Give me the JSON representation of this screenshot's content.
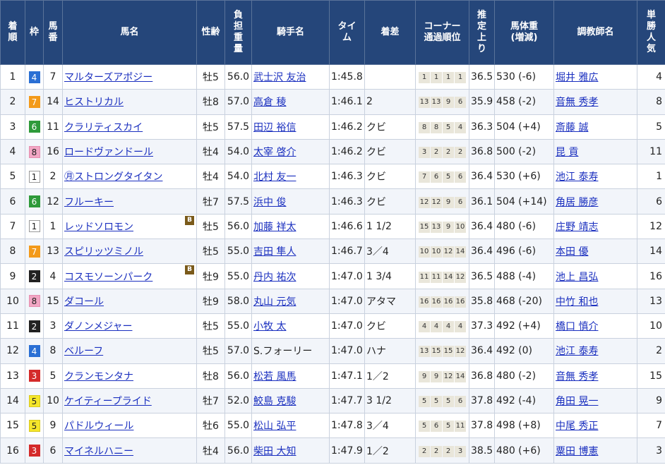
{
  "headers": {
    "rank": [
      "着",
      "順"
    ],
    "waku": [
      "枠"
    ],
    "umaban": [
      "馬",
      "番"
    ],
    "horse": [
      "馬名"
    ],
    "sexage": [
      "性齢"
    ],
    "weight": [
      "負",
      "担",
      "重",
      "量"
    ],
    "jockey": [
      "騎手名"
    ],
    "time": [
      "タイ",
      "ム"
    ],
    "margin": [
      "着差"
    ],
    "corner": [
      "コーナー",
      "通過順位"
    ],
    "last3f": [
      "推",
      "定",
      "上",
      "り"
    ],
    "bodyweight": [
      "馬体重",
      "(増減)"
    ],
    "trainer": [
      "調教師名"
    ],
    "popularity": [
      "単",
      "勝",
      "人",
      "気"
    ]
  },
  "waku_colors": {
    "1": {
      "bg": "#ffffff",
      "fg": "#222222",
      "border": "#999999"
    },
    "2": {
      "bg": "#222222",
      "fg": "#ffffff",
      "border": "#222222"
    },
    "3": {
      "bg": "#d42a2a",
      "fg": "#ffffff",
      "border": "#d42a2a"
    },
    "4": {
      "bg": "#2a6fd4",
      "fg": "#ffffff",
      "border": "#2a6fd4"
    },
    "5": {
      "bg": "#f5e62a",
      "fg": "#222222",
      "border": "#d8c820"
    },
    "6": {
      "bg": "#2e9a3a",
      "fg": "#ffffff",
      "border": "#2e9a3a"
    },
    "7": {
      "bg": "#f39a1a",
      "fg": "#ffffff",
      "border": "#f39a1a"
    },
    "8": {
      "bg": "#f2a6c4",
      "fg": "#222222",
      "border": "#e58fb0"
    }
  },
  "rows": [
    {
      "rank": "1",
      "waku": "4",
      "umaban": "7",
      "horse": "マルターズアポジー",
      "blinker": "",
      "sexage": "牡5",
      "weight": "56.0",
      "jockey": "武士沢 友治",
      "time": "1:45.8",
      "margin": "",
      "corner": [
        "1",
        "1",
        "1",
        "1"
      ],
      "last3f": "36.5",
      "bodyweight": "530 (-6)",
      "trainer": "堀井 雅広",
      "pop": "4"
    },
    {
      "rank": "2",
      "waku": "7",
      "umaban": "14",
      "horse": "ヒストリカル",
      "blinker": "",
      "sexage": "牡8",
      "weight": "57.0",
      "jockey": "高倉 稜",
      "time": "1:46.1",
      "margin": "2",
      "corner": [
        "13",
        "13",
        "9",
        "6"
      ],
      "last3f": "35.9",
      "bodyweight": "458 (-2)",
      "trainer": "音無 秀孝",
      "pop": "8"
    },
    {
      "rank": "3",
      "waku": "6",
      "umaban": "11",
      "horse": "クラリティスカイ",
      "blinker": "",
      "sexage": "牡5",
      "weight": "57.5",
      "jockey": "田辺 裕信",
      "time": "1:46.2",
      "margin": "クビ",
      "corner": [
        "8",
        "8",
        "5",
        "4"
      ],
      "last3f": "36.3",
      "bodyweight": "504 (+4)",
      "trainer": "斎藤 誠",
      "pop": "5"
    },
    {
      "rank": "4",
      "waku": "8",
      "umaban": "16",
      "horse": "ロードヴァンドール",
      "blinker": "",
      "sexage": "牡4",
      "weight": "54.0",
      "jockey": "太宰 啓介",
      "time": "1:46.2",
      "margin": "クビ",
      "corner": [
        "3",
        "2",
        "2",
        "2"
      ],
      "last3f": "36.8",
      "bodyweight": "500 (-2)",
      "trainer": "昆 貢",
      "pop": "11"
    },
    {
      "rank": "5",
      "waku": "1",
      "umaban": "2",
      "horse": "㊊ストロングタイタン",
      "blinker": "",
      "sexage": "牡4",
      "weight": "54.0",
      "jockey": "北村 友一",
      "time": "1:46.3",
      "margin": "クビ",
      "corner": [
        "7",
        "6",
        "5",
        "6"
      ],
      "last3f": "36.4",
      "bodyweight": "530 (+6)",
      "trainer": "池江 泰寿",
      "pop": "1"
    },
    {
      "rank": "6",
      "waku": "6",
      "umaban": "12",
      "horse": "フルーキー",
      "blinker": "",
      "sexage": "牡7",
      "weight": "57.5",
      "jockey": "浜中 俊",
      "time": "1:46.3",
      "margin": "クビ",
      "corner": [
        "12",
        "12",
        "9",
        "6"
      ],
      "last3f": "36.1",
      "bodyweight": "504 (+14)",
      "trainer": "角居 勝彦",
      "pop": "6"
    },
    {
      "rank": "7",
      "waku": "1",
      "umaban": "1",
      "horse": "レッドソロモン",
      "blinker": "B",
      "sexage": "牡5",
      "weight": "56.0",
      "jockey": "加藤 祥太",
      "time": "1:46.6",
      "margin": "1 1/2",
      "corner": [
        "15",
        "13",
        "9",
        "10"
      ],
      "last3f": "36.4",
      "bodyweight": "480 (-6)",
      "trainer": "庄野 靖志",
      "pop": "12"
    },
    {
      "rank": "8",
      "waku": "7",
      "umaban": "13",
      "horse": "スピリッツミノル",
      "blinker": "",
      "sexage": "牡5",
      "weight": "55.0",
      "jockey": "吉田 隼人",
      "time": "1:46.7",
      "margin": "3／4",
      "corner": [
        "10",
        "10",
        "12",
        "14"
      ],
      "last3f": "36.4",
      "bodyweight": "496 (-6)",
      "trainer": "本田 優",
      "pop": "14"
    },
    {
      "rank": "9",
      "waku": "2",
      "umaban": "4",
      "horse": "コスモソーンパーク",
      "blinker": "B",
      "sexage": "牡9",
      "weight": "55.0",
      "jockey": "丹内 祐次",
      "time": "1:47.0",
      "margin": "1 3/4",
      "corner": [
        "11",
        "11",
        "14",
        "12"
      ],
      "last3f": "36.5",
      "bodyweight": "488 (-4)",
      "trainer": "池上 昌弘",
      "pop": "16"
    },
    {
      "rank": "10",
      "waku": "8",
      "umaban": "15",
      "horse": "ダコール",
      "blinker": "",
      "sexage": "牡9",
      "weight": "58.0",
      "jockey": "丸山 元気",
      "time": "1:47.0",
      "margin": "アタマ",
      "corner": [
        "16",
        "16",
        "16",
        "16"
      ],
      "last3f": "35.8",
      "bodyweight": "468 (-20)",
      "trainer": "中竹 和也",
      "pop": "13"
    },
    {
      "rank": "11",
      "waku": "2",
      "umaban": "3",
      "horse": "ダノンメジャー",
      "blinker": "",
      "sexage": "牡5",
      "weight": "55.0",
      "jockey": "小牧 太",
      "time": "1:47.0",
      "margin": "クビ",
      "corner": [
        "4",
        "4",
        "4",
        "4"
      ],
      "last3f": "37.3",
      "bodyweight": "492 (+4)",
      "trainer": "橋口 慎介",
      "pop": "10"
    },
    {
      "rank": "12",
      "waku": "4",
      "umaban": "8",
      "horse": "ベルーフ",
      "blinker": "",
      "sexage": "牡5",
      "weight": "57.0",
      "jockey": "S.フォーリー",
      "time": "1:47.0",
      "margin": "ハナ",
      "corner": [
        "13",
        "15",
        "15",
        "12"
      ],
      "last3f": "36.4",
      "bodyweight": "492 (0)",
      "trainer": "池江 泰寿",
      "pop": "2"
    },
    {
      "rank": "13",
      "waku": "3",
      "umaban": "5",
      "horse": "クランモンタナ",
      "blinker": "",
      "sexage": "牡8",
      "weight": "56.0",
      "jockey": "松若 風馬",
      "time": "1:47.1",
      "margin": "1／2",
      "corner": [
        "9",
        "9",
        "12",
        "14"
      ],
      "last3f": "36.8",
      "bodyweight": "480 (-2)",
      "trainer": "音無 秀孝",
      "pop": "15"
    },
    {
      "rank": "14",
      "waku": "5",
      "umaban": "10",
      "horse": "ケイティープライド",
      "blinker": "",
      "sexage": "牡7",
      "weight": "52.0",
      "jockey": "鮫島 克駿",
      "time": "1:47.7",
      "margin": "3 1/2",
      "corner": [
        "5",
        "5",
        "5",
        "6"
      ],
      "last3f": "37.8",
      "bodyweight": "492 (-4)",
      "trainer": "角田 晃一",
      "pop": "9"
    },
    {
      "rank": "15",
      "waku": "5",
      "umaban": "9",
      "horse": "パドルウィール",
      "blinker": "",
      "sexage": "牡6",
      "weight": "55.0",
      "jockey": "松山 弘平",
      "time": "1:47.8",
      "margin": "3／4",
      "corner": [
        "5",
        "6",
        "5",
        "11"
      ],
      "last3f": "37.8",
      "bodyweight": "498 (+8)",
      "trainer": "中尾 秀正",
      "pop": "7"
    },
    {
      "rank": "16",
      "waku": "3",
      "umaban": "6",
      "horse": "マイネルハニー",
      "blinker": "",
      "sexage": "牡4",
      "weight": "56.0",
      "jockey": "柴田 大知",
      "time": "1:47.9",
      "margin": "1／2",
      "corner": [
        "2",
        "2",
        "2",
        "3"
      ],
      "last3f": "38.5",
      "bodyweight": "480 (+6)",
      "trainer": "粟田 博憲",
      "pop": "3"
    }
  ]
}
